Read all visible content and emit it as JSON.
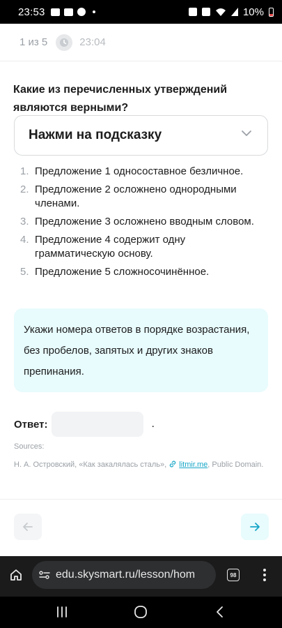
{
  "status": {
    "time": "23:53",
    "battery": "10%",
    "left_icons": [
      "gallery-icon",
      "youtube-icon",
      "chat-icon"
    ],
    "right_icons": [
      "alarm-icon",
      "mute-icon",
      "wifi-icon",
      "signal-icon",
      "battery-icon"
    ]
  },
  "header": {
    "progress": "1 из 5",
    "timer": "23:04"
  },
  "task": {
    "question": "Какие из перечисленных утверждений являются верными?",
    "hint_label": "Нажми на подсказку",
    "statements": [
      {
        "num": "1.",
        "text": "Предложение 1 односоставное безличное."
      },
      {
        "num": "2.",
        "text": "Предложение 2 осложнено однородными членами."
      },
      {
        "num": "3.",
        "text": "Предложение 3 осложнено вводным словом."
      },
      {
        "num": "4.",
        "text": "Предложение 4 содержит одну грамматическую основу."
      },
      {
        "num": "5.",
        "text": "Предложение 5 сложносочинённое."
      }
    ],
    "info": "Укажи номера ответов в порядке возрастания, без пробелов, запятых и других знаков препинания.",
    "answer_label": "Ответ:",
    "answer_value": "",
    "answer_suffix": ".",
    "sources_label": "Sources:",
    "sources_prefix": "Н. А. Островский, «Как закалялась сталь»,",
    "sources_link": "litmir.me",
    "sources_suffix": ", Public Domain."
  },
  "browser": {
    "url": "edu.skysmart.ru/lesson/hom",
    "tabs_count": "98"
  },
  "colors": {
    "accent": "#17a6c7",
    "info_bg": "#e8fbfd",
    "muted": "#9aa0a6"
  }
}
